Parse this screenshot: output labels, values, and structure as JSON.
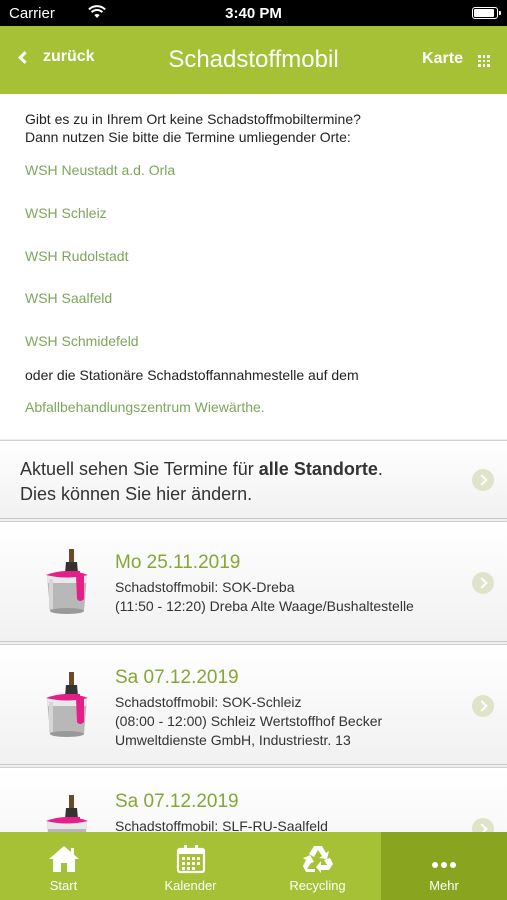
{
  "status_bar": {
    "carrier": "Carrier",
    "time": "3:40 PM"
  },
  "nav": {
    "back_label": "zurück",
    "title": "Schadstoffmobil",
    "map_label": "Karte"
  },
  "info": {
    "intro_line1": "Gibt es zu in Ihrem Ort keine Schadstoffmobiltermine?",
    "intro_line2": "Dann nutzen Sie bitte die Termine umliegender Orte:",
    "locations": [
      "WSH Neustadt a.d. Orla",
      "WSH Schleiz",
      "WSH Rudolstadt",
      "WSH Saalfeld",
      "WSH Schmidefeld"
    ],
    "station_text": "oder die Stationäre Schadstoffannahmestelle auf dem",
    "station_link": "Abfallbehandlungszentrum Wiewärthe."
  },
  "filter": {
    "line1_prefix": "Aktuell sehen Sie Termine für ",
    "line1_bold": "alle Standorte",
    "line1_suffix": ".",
    "line2": "Dies können Sie hier ändern."
  },
  "events": [
    {
      "date": "Mo 25.11.2019",
      "line1": "Schadstoffmobil: SOK-Dreba",
      "line2": "(11:50 - 12:20) Dreba Alte Waage/Bushaltestelle",
      "line3": ""
    },
    {
      "date": "Sa 07.12.2019",
      "line1": "Schadstoffmobil: SOK-Schleiz",
      "line2": "(08:00 - 12:00) Schleiz Wertstoffhof Becker",
      "line3": "Umweltdienste GmbH, Industriestr. 13"
    },
    {
      "date": "Sa 07.12.2019",
      "line1": "Schadstoffmobil: SLF-RU-Saalfeld",
      "line2": "",
      "line3": ""
    }
  ],
  "tabs": [
    {
      "label": "Start",
      "icon": "home-icon"
    },
    {
      "label": "Kalender",
      "icon": "calendar-icon"
    },
    {
      "label": "Recycling",
      "icon": "recycling-icon"
    },
    {
      "label": "Mehr",
      "icon": "more-icon",
      "active": true
    }
  ],
  "colors": {
    "brand_green": "#a6c136",
    "active_tab": "#89a51f",
    "link_green": "#7da55c",
    "date_green": "#86a637"
  }
}
